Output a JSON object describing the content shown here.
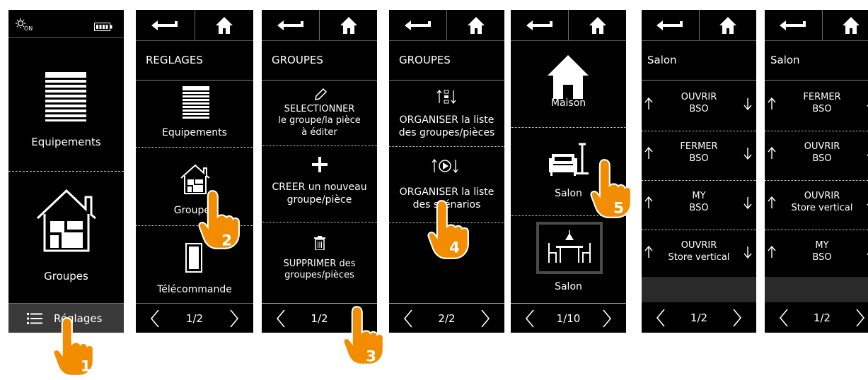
{
  "s1": {
    "battery_icon": "battery-icon",
    "sun_icon": "sun-on-icon",
    "equip": "Equipements",
    "groupes": "Groupes",
    "menu": "Réglages"
  },
  "s2": {
    "title": "REGLAGES",
    "items": [
      "Equipements",
      "Groupes",
      "Télécommande"
    ],
    "page": "1/2"
  },
  "s3": {
    "title": "GROUPES",
    "items": [
      [
        "SELECTIONNER",
        "le groupe/la pièce",
        "à éditer"
      ],
      [
        "CREER un nouveau",
        "groupe/pièce"
      ],
      [
        "SUPPRIMER des",
        "groupes/pièces"
      ]
    ],
    "page": "1/2"
  },
  "s4": {
    "title": "GROUPES",
    "items": [
      [
        "ORGANISER la liste",
        "des groupes/pièces"
      ],
      [
        "ORGANISER la liste",
        "des scénarios"
      ]
    ],
    "page": "2/2"
  },
  "s5": {
    "items": [
      "Maison",
      "Salon",
      "Salon"
    ],
    "page": "1/10"
  },
  "s6": {
    "title": "Salon",
    "rows": [
      [
        "OUVRIR",
        "BSO"
      ],
      [
        "FERMER",
        "BSO"
      ],
      [
        "MY",
        "BSO"
      ],
      [
        "OUVRIR",
        "Store vertical"
      ]
    ],
    "page": "1/2"
  },
  "s7": {
    "title": "Salon",
    "rows": [
      [
        "FERMER",
        "BSO"
      ],
      [
        "OUVRIR",
        "BSO"
      ],
      [
        "OUVRIR",
        "Store vertical"
      ],
      [
        "MY",
        "BSO"
      ]
    ],
    "page": "1/2"
  },
  "steps": [
    "1",
    "2",
    "3",
    "4",
    "5"
  ],
  "colors": {
    "hand": "#f28c00",
    "screen": "#000000",
    "text": "#ffffff"
  }
}
